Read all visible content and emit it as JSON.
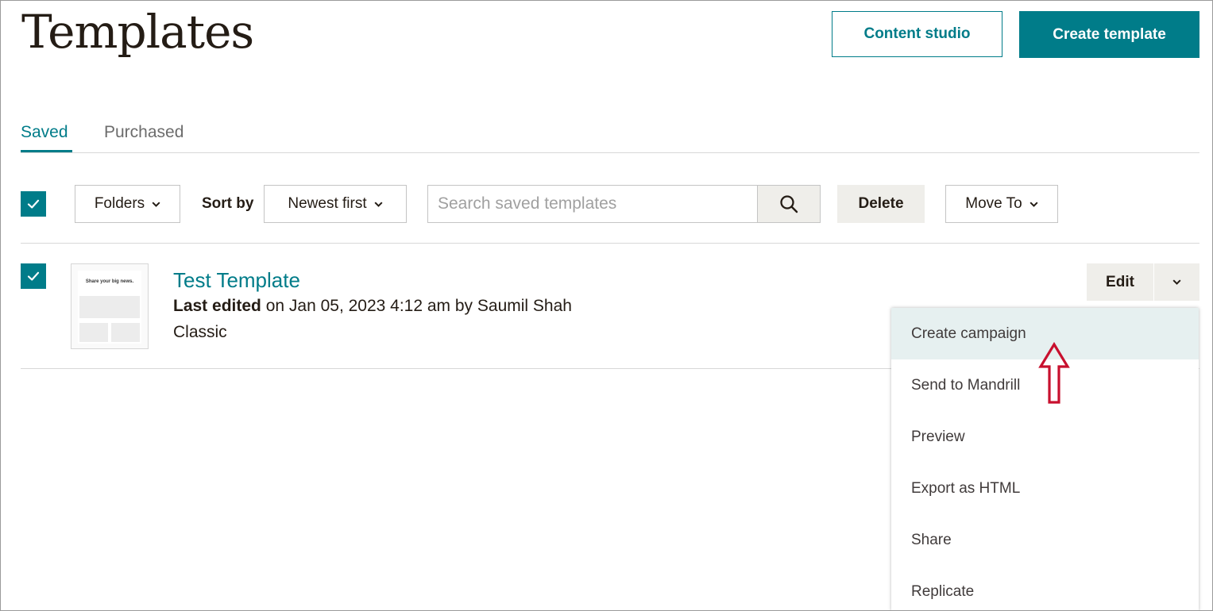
{
  "header": {
    "title": "Templates",
    "content_studio_label": "Content studio",
    "create_template_label": "Create template"
  },
  "tabs": [
    {
      "label": "Saved",
      "active": true
    },
    {
      "label": "Purchased",
      "active": false
    }
  ],
  "toolbar": {
    "select_all_checked": true,
    "folders_label": "Folders",
    "sort_by_label": "Sort by",
    "sort_value": "Newest first",
    "search_placeholder": "Search saved templates",
    "delete_label": "Delete",
    "move_to_label": "Move To"
  },
  "templates": [
    {
      "checked": true,
      "thumbnail_headline": "Share your big news.",
      "name": "Test Template",
      "last_edited_label": "Last edited",
      "last_edited_detail": " on Jan 05, 2023 4:12 am by Saumil Shah",
      "type": "Classic",
      "edit_label": "Edit"
    }
  ],
  "action_menu": {
    "items": [
      {
        "label": "Create campaign",
        "highlighted": true
      },
      {
        "label": "Send to Mandrill"
      },
      {
        "label": "Preview"
      },
      {
        "label": "Export as HTML"
      },
      {
        "label": "Share"
      },
      {
        "label": "Replicate"
      }
    ]
  },
  "colors": {
    "brand": "#007c89",
    "annotation_arrow": "#c8102e"
  }
}
